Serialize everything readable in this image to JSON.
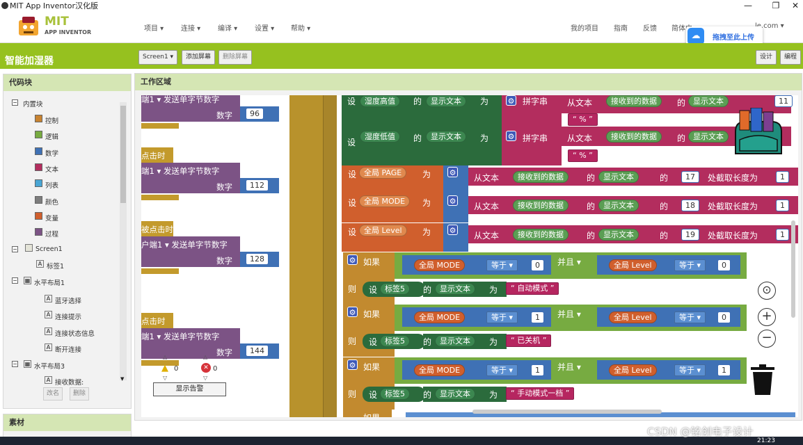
{
  "window": {
    "title": "MIT App Inventor汉化版",
    "minimize": "—",
    "restore": "❐",
    "close": "✕"
  },
  "topnav": {
    "logo_mit": "MIT",
    "logo_sub": "APP INVENTOR",
    "menu": [
      "项目 ▾",
      "连接 ▾",
      "编译 ▾",
      "设置 ▾",
      "帮助 ▾"
    ],
    "right": [
      "我的项目",
      "指南",
      "反馈",
      "简体中",
      "le.com ▾"
    ],
    "upload_badge": "拖拽至此上传"
  },
  "toolbar": {
    "project_title": "智能加湿器",
    "screen_select": "Screen1 ▾",
    "add_screen": "添加屏幕",
    "remove_screen": "删除屏幕",
    "designer": "设计",
    "blocks": "编程"
  },
  "blocks_panel": {
    "title": "代码块",
    "builtin": "内置块",
    "builtin_items": [
      {
        "label": "控制",
        "color": "#c88330"
      },
      {
        "label": "逻辑",
        "color": "#77ab41"
      },
      {
        "label": "数学",
        "color": "#3f71b5"
      },
      {
        "label": "文本",
        "color": "#b32d5e"
      },
      {
        "label": "列表",
        "color": "#49a6d4"
      },
      {
        "label": "颜色",
        "color": "#7d7d7d"
      },
      {
        "label": "变量",
        "color": "#d05f2d"
      },
      {
        "label": "过程",
        "color": "#7c5385"
      }
    ],
    "screen": "Screen1",
    "components": [
      {
        "label": "标签1",
        "indent": 2
      },
      {
        "label": "水平布局1",
        "indent": 1
      },
      {
        "label": "蓝牙选择",
        "indent": 3
      },
      {
        "label": "连接提示",
        "indent": 3
      },
      {
        "label": "连接状态信息",
        "indent": 3
      },
      {
        "label": "断开连接",
        "indent": 3
      },
      {
        "label": "水平布局3",
        "indent": 1
      },
      {
        "label": "接收数据:",
        "indent": 3
      }
    ],
    "rename": "改名",
    "delete": "删除",
    "media_title": "素材"
  },
  "workspace": {
    "title": "工作区域",
    "left_blocks": [
      {
        "event": "",
        "call": "端1 ▾  发送单字节数字",
        "num_label": "数字",
        "num": "96"
      },
      {
        "event": "点击时",
        "call": "端1 ▾  发送单字节数字",
        "num_label": "数字",
        "num": "112"
      },
      {
        "event": "被点击时",
        "call": "户端1 ▾  发送单字节数字",
        "num_label": "数字",
        "num": "128"
      },
      {
        "event": "点击时",
        "call": "端1 ▾  发送单字节数字",
        "num_label": "数字",
        "num": "144"
      }
    ],
    "warnings": {
      "warn_count": "0",
      "error_count": "0",
      "show_label": "显示告警"
    },
    "set_rows": [
      {
        "set": "设",
        "target": "湿度高值",
        "prop_of": "的",
        "prop": "显示文本",
        "to": "为",
        "join": "拼字串",
        "from_text": "从文本",
        "recv": "接收到的数据",
        "recv_prop": "显示文本",
        "at": "的",
        "idx": "11",
        "pct": "%"
      },
      {
        "set": "设",
        "target": "湿度低值",
        "prop_of": "的",
        "prop": "显示文本",
        "to": "为",
        "join": "拼字串",
        "from_text": "从文本",
        "recv": "接收到的数据",
        "recv_prop": "显示文本",
        "at": "的",
        "idx": "",
        "pct": "%"
      }
    ],
    "global_rows": [
      {
        "set": "设",
        "var": "全局 PAGE",
        "to": "为",
        "from_text": "从文本",
        "recv": "接收到的数据",
        "of": "的",
        "prop": "显示文本",
        "at": "的",
        "start": "17",
        "len_label": "处截取长度为",
        "len": "1"
      },
      {
        "set": "设",
        "var": "全局 MODE",
        "to": "为",
        "from_text": "从文本",
        "recv": "接收到的数据",
        "of": "的",
        "prop": "显示文本",
        "at": "的",
        "start": "18",
        "len_label": "处截取长度为",
        "len": "1"
      },
      {
        "set": "设",
        "var": "全局 Level",
        "to": "为",
        "from_text": "从文本",
        "recv": "接收到的数据",
        "of": "的",
        "prop": "显示文本",
        "at": "的",
        "start": "19",
        "len_label": "处截取长度为",
        "len": "1"
      }
    ],
    "if_rows": [
      {
        "if": "如果",
        "mode": "全局 MODE",
        "eq1": "等于 ▾",
        "v1": "0",
        "and": "并且 ▾",
        "level": "全局 Level",
        "eq2": "等于 ▾",
        "v2": "0",
        "then": "则",
        "set": "设",
        "label": "标签5",
        "of": "的",
        "prop": "显示文本",
        "to": "为",
        "text": "自动模式"
      },
      {
        "if": "如果",
        "mode": "全局 MODE",
        "eq1": "等于 ▾",
        "v1": "1",
        "and": "并且 ▾",
        "level": "全局 Level",
        "eq2": "等于 ▾",
        "v2": "0",
        "then": "则",
        "set": "设",
        "label": "标签5",
        "of": "的",
        "prop": "显示文本",
        "to": "为",
        "text": "已关机"
      },
      {
        "if": "如果",
        "mode": "全局 MODE",
        "eq1": "等于 ▾",
        "v1": "1",
        "and": "并且 ▾",
        "level": "全局 Level",
        "eq2": "等于 ▾",
        "v2": "1",
        "then": "则",
        "set": "设",
        "label": "标签5",
        "of": "的",
        "prop": "显示文本",
        "to": "为",
        "text": "手动模式一档"
      }
    ],
    "last_if": "如果"
  },
  "taskbar": {
    "time": "21:23",
    "watermark": "CSDN @铭创电子设计"
  }
}
